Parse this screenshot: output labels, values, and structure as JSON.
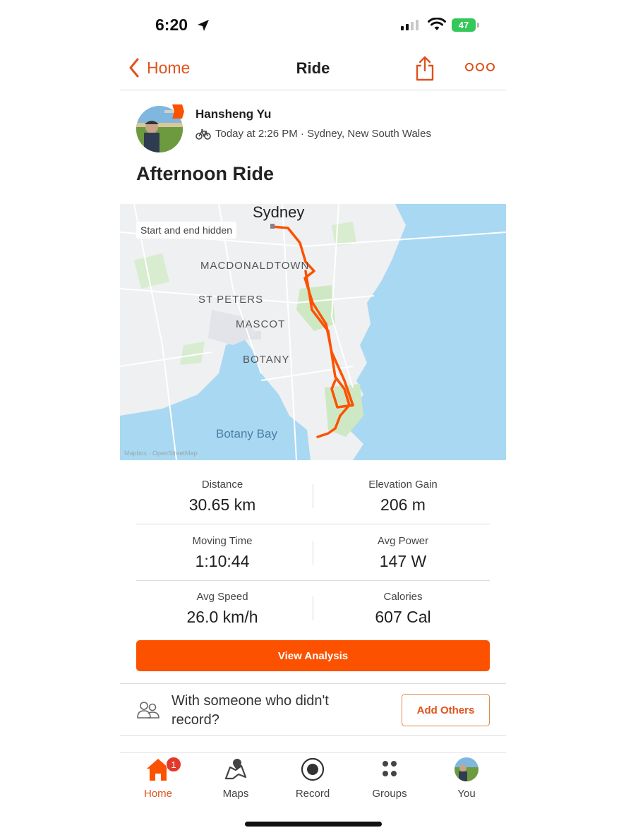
{
  "status_bar": {
    "time": "6:20",
    "battery": "47"
  },
  "nav": {
    "back_label": "Home",
    "title": "Ride"
  },
  "athlete": {
    "name": "Hansheng Yu",
    "meta": "Today at 2:26 PM · Sydney, New South Wales"
  },
  "activity": {
    "title": "Afternoon Ride"
  },
  "map": {
    "chip": "Start and end hidden",
    "city": "Sydney",
    "labels": [
      "MACDONALDTOWN",
      "ST PETERS",
      "MASCOT",
      "BOTANY",
      "Botany Bay"
    ],
    "attribution": "Mapbox · OpenStreetMap",
    "route_color": "#fc5200"
  },
  "stats": [
    {
      "label": "Distance",
      "value": "30.65 km"
    },
    {
      "label": "Elevation Gain",
      "value": "206 m"
    },
    {
      "label": "Moving Time",
      "value": "1:10:44"
    },
    {
      "label": "Avg Power",
      "value": "147 W"
    },
    {
      "label": "Avg Speed",
      "value": "26.0 km/h"
    },
    {
      "label": "Calories",
      "value": "607 Cal"
    }
  ],
  "actions": {
    "view_analysis": "View Analysis",
    "with_someone": "With someone who didn't record?",
    "add_others": "Add Others"
  },
  "tabs": [
    {
      "label": "Home",
      "icon": "home-icon",
      "badge": "1",
      "active": true
    },
    {
      "label": "Maps",
      "icon": "maps-icon"
    },
    {
      "label": "Record",
      "icon": "record-icon"
    },
    {
      "label": "Groups",
      "icon": "groups-icon"
    },
    {
      "label": "You",
      "icon": "avatar"
    }
  ],
  "colors": {
    "accent": "#fc5200",
    "link": "#e0521b",
    "water": "#a9d8f2",
    "land": "#eef0f1",
    "park": "#cfe8c4"
  }
}
